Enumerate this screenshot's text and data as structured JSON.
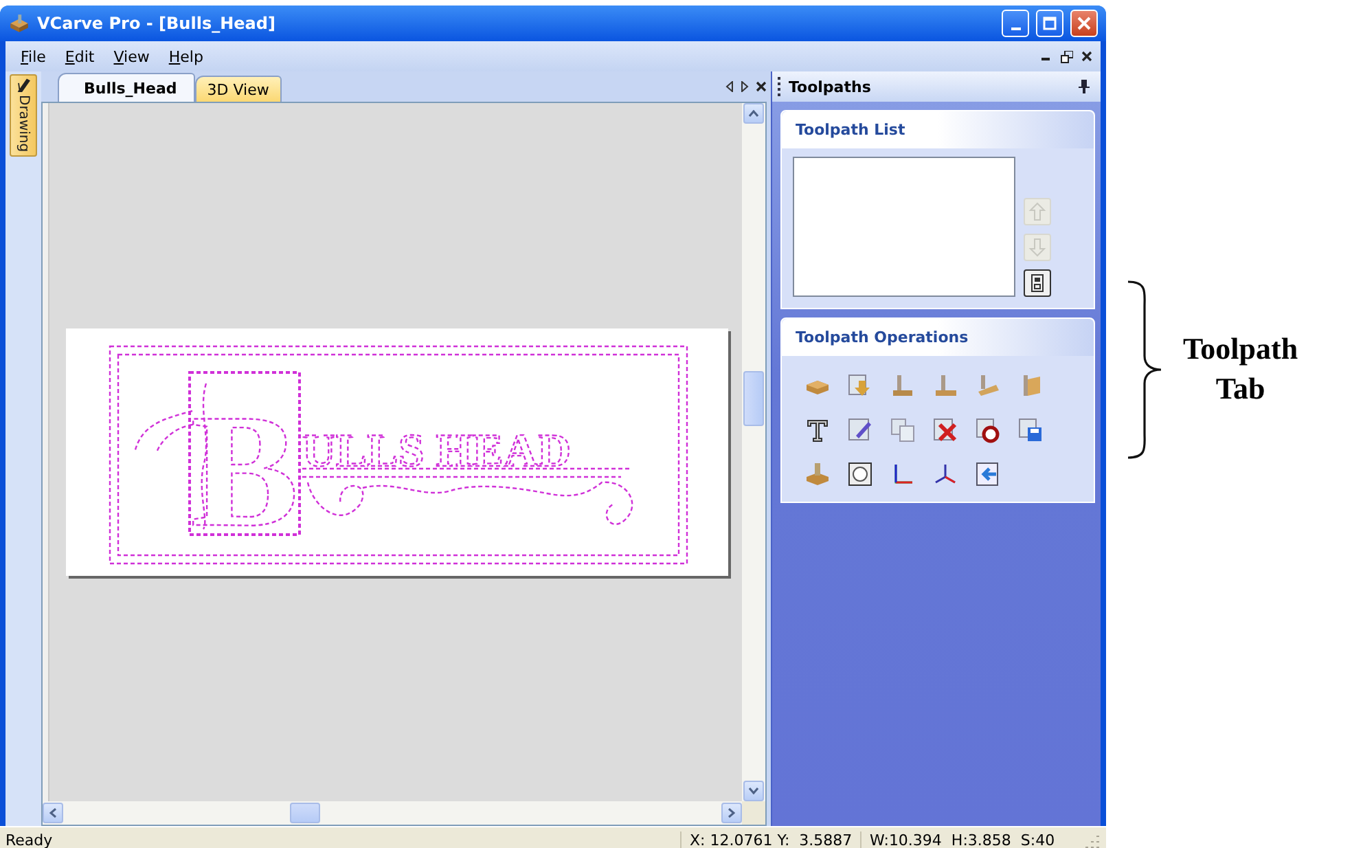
{
  "window": {
    "title": "VCarve Pro - [Bulls_Head]"
  },
  "menu": [
    {
      "label": "File"
    },
    {
      "label": "Edit"
    },
    {
      "label": "View"
    },
    {
      "label": "Help"
    }
  ],
  "side_tab": {
    "label": "Drawing"
  },
  "doc_tabs": [
    {
      "label": "Bulls_Head",
      "selected": true
    },
    {
      "label": "3D View",
      "selected": false
    }
  ],
  "design": {
    "initial": "B",
    "rest": "ULLS HEAD"
  },
  "panel": {
    "title": "Toolpaths",
    "sections": [
      {
        "title": "Toolpath List",
        "kind": "list"
      },
      {
        "title": "Toolpath Operations",
        "kind": "operations"
      }
    ]
  },
  "list_buttons": [
    {
      "kind": "up",
      "disabled": true
    },
    {
      "kind": "down",
      "disabled": true
    },
    {
      "kind": "calc",
      "disabled": false
    }
  ],
  "status_bar": {
    "message": "Ready",
    "coords": "X: 12.0761 Y:  3.5887",
    "size": "W:10.394  H:3.858  S:40"
  },
  "annotation": {
    "text": "Toolpath Tab"
  }
}
